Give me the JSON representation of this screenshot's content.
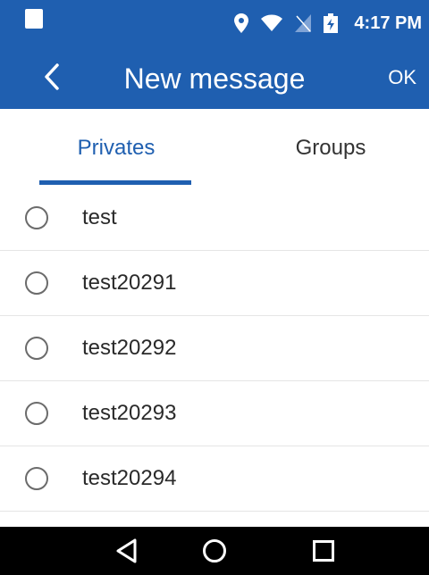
{
  "status_bar": {
    "time": "4:17 PM",
    "icons": [
      "notification-square-icon",
      "location-pin-icon",
      "wifi-icon",
      "no-sim-icon",
      "battery-charging-icon"
    ]
  },
  "app_bar": {
    "back_icon": "chevron-left-icon",
    "title": "New message",
    "ok_label": "OK"
  },
  "tabs": {
    "items": [
      {
        "label": "Privates",
        "selected": true
      },
      {
        "label": "Groups",
        "selected": false
      }
    ]
  },
  "contacts": [
    {
      "name": "test",
      "selected": false
    },
    {
      "name": "test20291",
      "selected": false
    },
    {
      "name": "test20292",
      "selected": false
    },
    {
      "name": "test20293",
      "selected": false
    },
    {
      "name": "test20294",
      "selected": false
    }
  ],
  "nav_bar": {
    "icons": [
      "back-triangle-icon",
      "home-circle-icon",
      "recents-square-icon"
    ]
  },
  "colors": {
    "primary": "#1f5fb0",
    "nav_bar": "#000000",
    "radio_border": "#6b6b6b"
  }
}
